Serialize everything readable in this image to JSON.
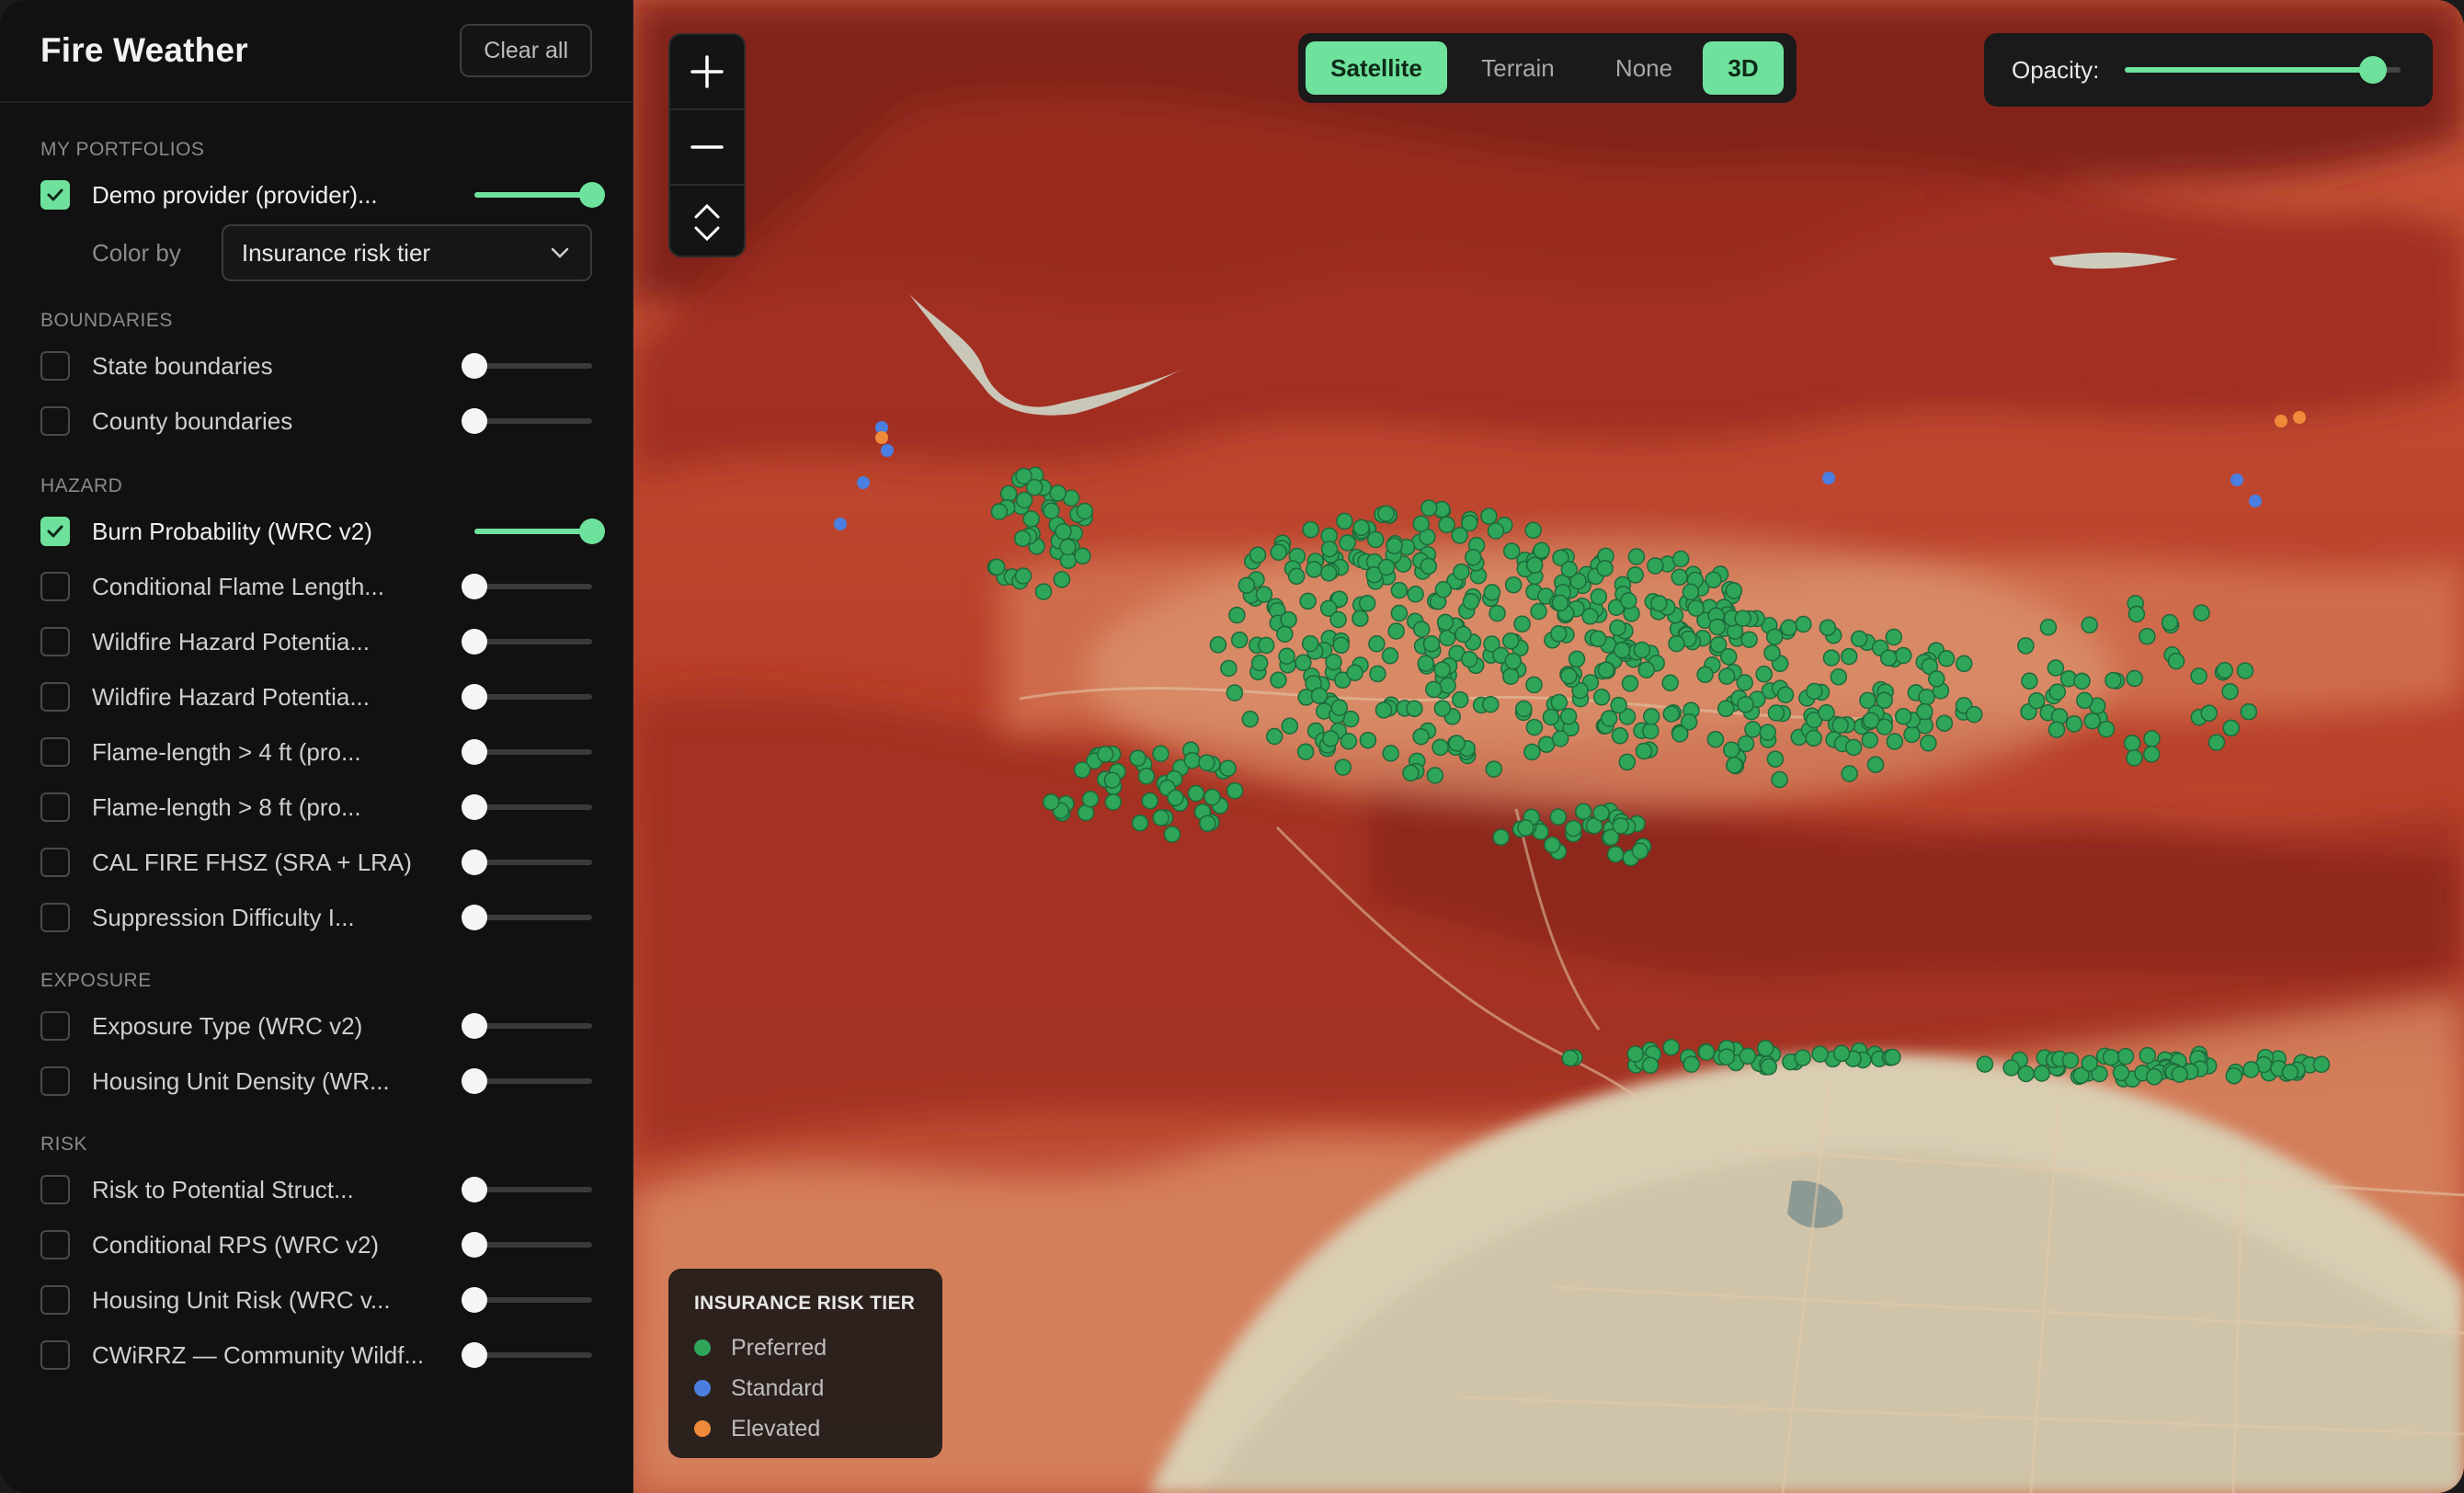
{
  "app": {
    "title": "Fire Weather",
    "clear_label": "Clear all"
  },
  "portfolios": {
    "heading": "MY PORTFOLIOS",
    "items": [
      {
        "label": "Demo provider (provider)...",
        "checked": true,
        "opacity": 1.0
      }
    ],
    "color_by_label": "Color by",
    "color_by_value": "Insurance risk tier"
  },
  "boundaries": {
    "heading": "BOUNDARIES",
    "items": [
      {
        "label": "State boundaries",
        "checked": false,
        "opacity": 0
      },
      {
        "label": "County boundaries",
        "checked": false,
        "opacity": 0
      }
    ]
  },
  "hazard": {
    "heading": "HAZARD",
    "items": [
      {
        "label": "Burn Probability (WRC v2)",
        "checked": true,
        "opacity": 1.0
      },
      {
        "label": "Conditional Flame Length...",
        "checked": false,
        "opacity": 0
      },
      {
        "label": "Wildfire Hazard Potentia...",
        "checked": false,
        "opacity": 0
      },
      {
        "label": "Wildfire Hazard Potentia...",
        "checked": false,
        "opacity": 0
      },
      {
        "label": "Flame-length > 4 ft (pro...",
        "checked": false,
        "opacity": 0
      },
      {
        "label": "Flame-length > 8 ft (pro...",
        "checked": false,
        "opacity": 0
      },
      {
        "label": "CAL FIRE FHSZ (SRA + LRA)",
        "checked": false,
        "opacity": 0
      },
      {
        "label": "Suppression Difficulty I...",
        "checked": false,
        "opacity": 0
      }
    ]
  },
  "exposure": {
    "heading": "EXPOSURE",
    "items": [
      {
        "label": "Exposure Type (WRC v2)",
        "checked": false,
        "opacity": 0
      },
      {
        "label": "Housing Unit Density (WR...",
        "checked": false,
        "opacity": 0
      }
    ]
  },
  "risk": {
    "heading": "RISK",
    "items": [
      {
        "label": "Risk to Potential Struct...",
        "checked": false,
        "opacity": 0
      },
      {
        "label": "Conditional RPS (WRC v2)",
        "checked": false,
        "opacity": 0
      },
      {
        "label": "Housing Unit Risk (WRC v...",
        "checked": false,
        "opacity": 0
      },
      {
        "label": "CWiRRZ — Community Wildf...",
        "checked": false,
        "opacity": 0
      }
    ]
  },
  "map": {
    "basemap_options": [
      "Satellite",
      "Terrain",
      "None"
    ],
    "basemap_selected": "Satellite",
    "three_d_label": "3D",
    "three_d_on": true,
    "opacity_label": "Opacity:",
    "opacity_value": 0.9,
    "legend": {
      "title": "INSURANCE RISK TIER",
      "items": [
        {
          "label": "Preferred",
          "color": "#2fa55a"
        },
        {
          "label": "Standard",
          "color": "#4a7ee0"
        },
        {
          "label": "Elevated",
          "color": "#ef8a3a"
        }
      ]
    }
  },
  "colors": {
    "accent": "#6ee29c"
  }
}
